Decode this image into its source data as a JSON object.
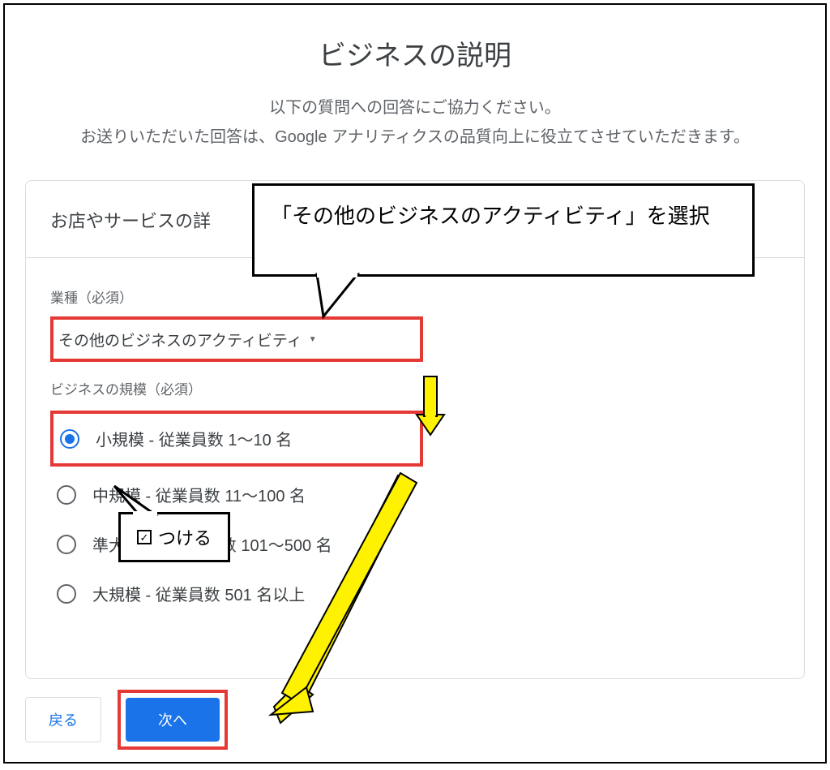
{
  "header": {
    "title": "ビジネスの説明",
    "subtitle_line1": "以下の質問への回答にご協力ください。",
    "subtitle_line2_before": "お送りいただいた回答は、",
    "subtitle_line2_brand": "Google",
    "subtitle_line2_after": " アナリティクスの品質向上に役立てさせていただきます。"
  },
  "card": {
    "heading": "お店やサービスの詳",
    "industry_label": "業種（必須）",
    "industry_value": "その他のビジネスのアクティビティ",
    "size_label": "ビジネスの規模（必須）",
    "options": [
      {
        "label": "小規模 - 従業員数 1〜10 名",
        "selected": true
      },
      {
        "label": "中規模 - 従業員数 11〜100 名",
        "selected": false
      },
      {
        "label": "準大規模 - 従業員数 101〜500 名",
        "selected": false
      },
      {
        "label": "大規模 - 従業員数 501 名以上",
        "selected": false
      }
    ]
  },
  "footer": {
    "back": "戻る",
    "next": "次へ"
  },
  "annotations": {
    "callout1": "「その他のビジネスのアクティビティ」を選択",
    "callout2": "つける"
  }
}
